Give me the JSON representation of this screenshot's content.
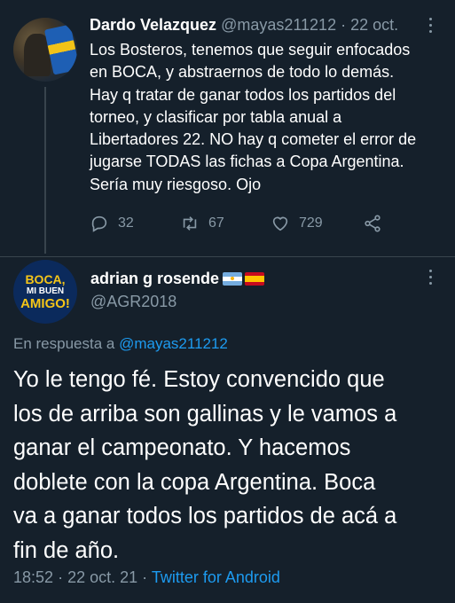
{
  "tweet1": {
    "name": "Dardo Velazquez",
    "handle": "@mayas211212",
    "separator": "·",
    "date": "22 oct.",
    "text": "Los Bosteros, tenemos que seguir enfocados\nen BOCA, y abstraernos de todo lo demás.\nHay q tratar de ganar todos los partidos del\ntorneo, y clasificar por tabla anual a\nLibertadores 22. NO hay q cometer el error de\njugarse TODAS las fichas a Copa Argentina.\nSería muy riesgoso. Ojo",
    "replies": "32",
    "retweets": "67",
    "likes": "729"
  },
  "tweet2": {
    "avatar_text": [
      "BOCA,",
      "MI BUEN",
      "AMIGO!"
    ],
    "name": "adrian g rosende",
    "handle": "@AGR2018",
    "reply_prefix": "En respuesta a",
    "reply_mention": "@mayas211212",
    "text": "Yo le tengo fé. Estoy convencido que\nlos de arriba son gallinas y le vamos a\nganar el campeonato. Y hacemos\ndoblete con la copa Argentina. Boca\nva a ganar todos los partidos de acá a\nfin de año.",
    "time": "18:52",
    "separator": "·",
    "date": "22 oct. 21",
    "client": "Twitter for Android"
  },
  "colors": {
    "background": "#15202b",
    "secondary_text": "#8899a6",
    "link": "#1d9bf0",
    "divider": "#38444d"
  },
  "icons": [
    "reply-icon",
    "retweet-icon",
    "like-icon",
    "share-icon",
    "more-icon"
  ]
}
